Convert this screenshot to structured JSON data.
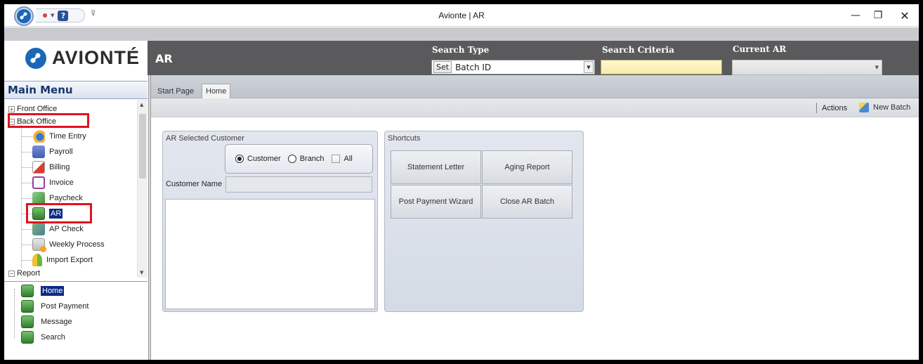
{
  "window": {
    "title": "Avionte | AR"
  },
  "titlebar": {
    "minimize_glyph": "—",
    "maximize_glyph": "❐",
    "close_glyph": "✕",
    "help_glyph": "?",
    "more_glyph": "⊽"
  },
  "header": {
    "logo_text": "AVIONTÉ",
    "module_title": "AR",
    "search_type": {
      "label": "Search Type",
      "set_label": "Set",
      "value": "Batch ID"
    },
    "search_criteria": {
      "label": "Search Criteria",
      "value": ""
    },
    "current_ar": {
      "label": "Current AR",
      "value": ""
    }
  },
  "main_menu": {
    "title": "Main Menu",
    "groups": [
      {
        "label": "Front Office",
        "expander": "+"
      },
      {
        "label": "Back Office",
        "expander": "−"
      },
      {
        "label": "Report",
        "expander": "−"
      }
    ],
    "back_office_items": [
      {
        "label": "Time Entry",
        "icon": "clock-icon"
      },
      {
        "label": "Payroll",
        "icon": "calculator-icon"
      },
      {
        "label": "Billing",
        "icon": "billing-icon"
      },
      {
        "label": "Invoice",
        "icon": "invoice-icon"
      },
      {
        "label": "Paycheck",
        "icon": "paycheck-icon"
      },
      {
        "label": "AR",
        "icon": "ledger-icon",
        "selected": true
      },
      {
        "label": "AP Check",
        "icon": "ap-check-icon"
      },
      {
        "label": "Weekly Process",
        "icon": "weekly-process-icon"
      },
      {
        "label": "Import Export",
        "icon": "import-export-icon"
      }
    ]
  },
  "sub_menu": {
    "items": [
      {
        "label": "Home",
        "selected": true
      },
      {
        "label": "Post Payment"
      },
      {
        "label": "Message"
      },
      {
        "label": "Search"
      }
    ]
  },
  "tabs": [
    {
      "label": "Start Page"
    },
    {
      "label": "Home",
      "active": true
    }
  ],
  "actions": {
    "actions_label": "Actions",
    "new_batch_label": "New Batch"
  },
  "ar_selected_customer": {
    "title": "AR Selected Customer",
    "radio_customer": "Customer",
    "radio_branch": "Branch",
    "checkbox_all": "All",
    "customer_name_label": "Customer Name",
    "selected_option": "Customer"
  },
  "shortcuts": {
    "title": "Shortcuts",
    "buttons": [
      "Statement Letter",
      "Aging Report",
      "Post Payment Wizard",
      "Close AR Batch"
    ]
  },
  "colors": {
    "header_bg": "#5a5a5c",
    "selection": "#0c2b86",
    "highlight_box": "#e0141e",
    "brand_blue": "#1b67b7"
  }
}
